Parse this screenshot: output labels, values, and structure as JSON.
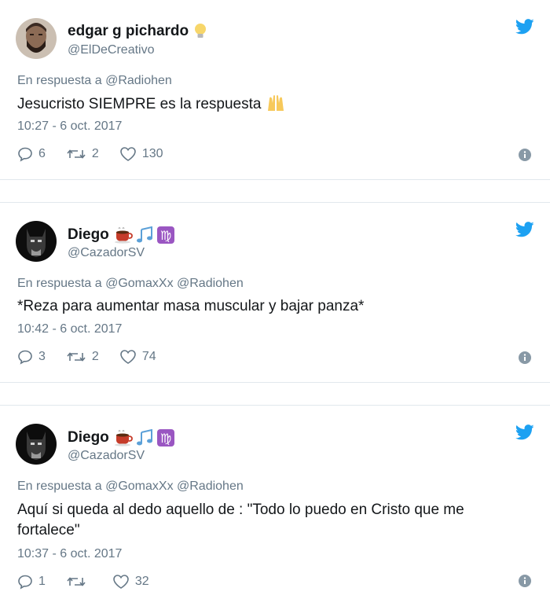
{
  "tweets": [
    {
      "name": "edgar g pichardo",
      "handle": "@ElDeCreativo",
      "reply_prefix": "En respuesta a",
      "reply_to": "@Radiohen",
      "text": "Jesucristo SIEMPRE es la respuesta",
      "time": "10:27 - 6 oct. 2017",
      "replies": "6",
      "retweets": "2",
      "likes": "130"
    },
    {
      "name": "Diego",
      "handle": "@CazadorSV",
      "reply_prefix": "En respuesta a",
      "reply_to": "@GomaxXx @Radiohen",
      "text": "*Reza para aumentar masa muscular y bajar panza*",
      "time": "10:42 - 6 oct. 2017",
      "replies": "3",
      "retweets": "2",
      "likes": "74"
    },
    {
      "name": "Diego",
      "handle": "@CazadorSV",
      "reply_prefix": "En respuesta a",
      "reply_to": "@GomaxXx @Radiohen",
      "text": "Aquí si queda al dedo aquello de : \"Todo lo puedo en Cristo que me fortalece\"",
      "time": "10:37 - 6 oct. 2017",
      "replies": "1",
      "retweets": "",
      "likes": "32"
    }
  ],
  "icons": {
    "bird": "twitter-bird-icon",
    "reply": "reply-icon",
    "retweet": "retweet-icon",
    "like": "heart-icon",
    "info": "info-icon",
    "bulb": "light-bulb-emoji",
    "hands": "raised-hands-emoji",
    "coffee": "coffee-emoji",
    "notes": "music-notes-emoji",
    "virgo": "virgo-emoji"
  },
  "colors": {
    "twitter_blue": "#1da1f2",
    "secondary_text": "#657786",
    "primary_text": "#14171a",
    "border": "#e1e8ed"
  }
}
